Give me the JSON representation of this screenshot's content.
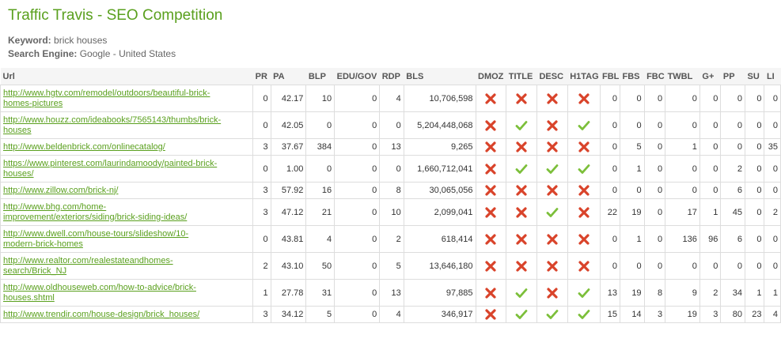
{
  "title": "Traffic Travis - SEO Competition",
  "keyword": {
    "label": "Keyword:",
    "value": "brick houses"
  },
  "engine": {
    "label": "Search Engine:",
    "value": "Google - United States"
  },
  "columns": [
    "Url",
    "PR",
    "PA",
    "BLP",
    "EDU/GOV",
    "RDP",
    "BLS",
    "DMOZ",
    "TITLE",
    "DESC",
    "H1TAG",
    "FBL",
    "FBS",
    "FBC",
    "TWBL",
    "G+",
    "PP",
    "SU",
    "LI"
  ],
  "colors": {
    "check": "#7cbf3a",
    "cross": "#d9432a",
    "link": "#5aa01e",
    "title": "#5aa01e"
  },
  "rows": [
    {
      "url": [
        "http://www.hgtv.com/remodel/outdoors/beautiful-brick-",
        "homes-pictures"
      ],
      "pr": "0",
      "pa": "42.17",
      "blp": "10",
      "edu": "0",
      "rdp": "4",
      "bls": "10,706,598",
      "dmoz": "cross",
      "title": "cross",
      "desc": "cross",
      "h1": "cross",
      "fbl": "0",
      "fbs": "0",
      "fbc": "0",
      "twbl": "0",
      "gp": "0",
      "pp": "0",
      "su": "0",
      "li": "0"
    },
    {
      "url": [
        "http://www.houzz.com/ideabooks/7565143/thumbs/brick-",
        "houses"
      ],
      "pr": "0",
      "pa": "42.05",
      "blp": "0",
      "edu": "0",
      "rdp": "0",
      "bls": "5,204,448,068",
      "dmoz": "cross",
      "title": "check",
      "desc": "cross",
      "h1": "check",
      "fbl": "0",
      "fbs": "0",
      "fbc": "0",
      "twbl": "0",
      "gp": "0",
      "pp": "0",
      "su": "0",
      "li": "0"
    },
    {
      "url": [
        "http://www.beldenbrick.com/onlinecatalog/"
      ],
      "pr": "3",
      "pa": "37.67",
      "blp": "384",
      "edu": "0",
      "rdp": "13",
      "bls": "9,265",
      "dmoz": "cross",
      "title": "cross",
      "desc": "cross",
      "h1": "cross",
      "fbl": "0",
      "fbs": "5",
      "fbc": "0",
      "twbl": "1",
      "gp": "0",
      "pp": "0",
      "su": "0",
      "li": "35"
    },
    {
      "url": [
        "https://www.pinterest.com/laurindamoody/painted-brick-",
        "houses/"
      ],
      "pr": "0",
      "pa": "1.00",
      "blp": "0",
      "edu": "0",
      "rdp": "0",
      "bls": "1,660,712,041",
      "dmoz": "cross",
      "title": "check",
      "desc": "check",
      "h1": "check",
      "fbl": "0",
      "fbs": "1",
      "fbc": "0",
      "twbl": "0",
      "gp": "0",
      "pp": "2",
      "su": "0",
      "li": "0"
    },
    {
      "url": [
        "http://www.zillow.com/brick-nj/"
      ],
      "pr": "3",
      "pa": "57.92",
      "blp": "16",
      "edu": "0",
      "rdp": "8",
      "bls": "30,065,056",
      "dmoz": "cross",
      "title": "cross",
      "desc": "cross",
      "h1": "cross",
      "fbl": "0",
      "fbs": "0",
      "fbc": "0",
      "twbl": "0",
      "gp": "0",
      "pp": "6",
      "su": "0",
      "li": "0"
    },
    {
      "url": [
        "http://www.bhg.com/home-",
        "improvement/exteriors/siding/brick-siding-ideas/"
      ],
      "pr": "3",
      "pa": "47.12",
      "blp": "21",
      "edu": "0",
      "rdp": "10",
      "bls": "2,099,041",
      "dmoz": "cross",
      "title": "cross",
      "desc": "check",
      "h1": "cross",
      "fbl": "22",
      "fbs": "19",
      "fbc": "0",
      "twbl": "17",
      "gp": "1",
      "pp": "45",
      "su": "0",
      "li": "2"
    },
    {
      "url": [
        "http://www.dwell.com/house-tours/slideshow/10-",
        "modern-brick-homes"
      ],
      "pr": "0",
      "pa": "43.81",
      "blp": "4",
      "edu": "0",
      "rdp": "2",
      "bls": "618,414",
      "dmoz": "cross",
      "title": "cross",
      "desc": "cross",
      "h1": "cross",
      "fbl": "0",
      "fbs": "1",
      "fbc": "0",
      "twbl": "136",
      "gp": "96",
      "pp": "6",
      "su": "0",
      "li": "0"
    },
    {
      "url": [
        "http://www.realtor.com/realestateandhomes-",
        "search/Brick_NJ"
      ],
      "pr": "2",
      "pa": "43.10",
      "blp": "50",
      "edu": "0",
      "rdp": "5",
      "bls": "13,646,180",
      "dmoz": "cross",
      "title": "cross",
      "desc": "cross",
      "h1": "cross",
      "fbl": "0",
      "fbs": "0",
      "fbc": "0",
      "twbl": "0",
      "gp": "0",
      "pp": "0",
      "su": "0",
      "li": "0"
    },
    {
      "url": [
        "http://www.oldhouseweb.com/how-to-advice/brick-",
        "houses.shtml"
      ],
      "pr": "1",
      "pa": "27.78",
      "blp": "31",
      "edu": "0",
      "rdp": "13",
      "bls": "97,885",
      "dmoz": "cross",
      "title": "check",
      "desc": "cross",
      "h1": "check",
      "fbl": "13",
      "fbs": "19",
      "fbc": "8",
      "twbl": "9",
      "gp": "2",
      "pp": "34",
      "su": "1",
      "li": "1"
    },
    {
      "url": [
        "http://www.trendir.com/house-design/brick_houses/"
      ],
      "pr": "3",
      "pa": "34.12",
      "blp": "5",
      "edu": "0",
      "rdp": "4",
      "bls": "346,917",
      "dmoz": "cross",
      "title": "check",
      "desc": "check",
      "h1": "check",
      "fbl": "15",
      "fbs": "14",
      "fbc": "3",
      "twbl": "19",
      "gp": "3",
      "pp": "80",
      "su": "23",
      "li": "4"
    }
  ]
}
